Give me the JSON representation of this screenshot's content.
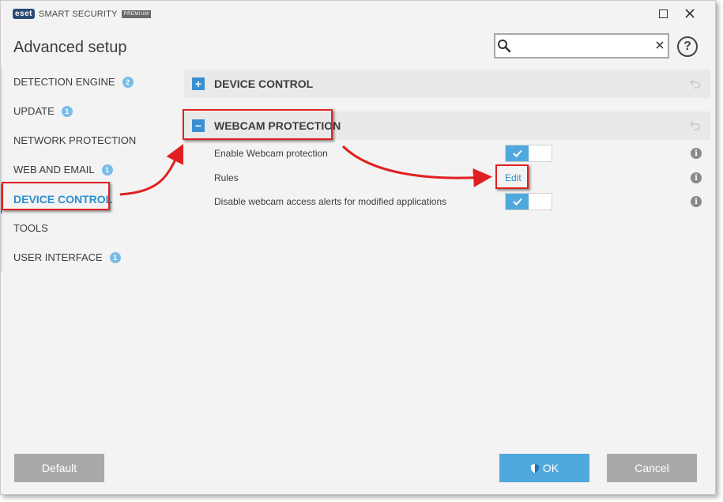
{
  "titlebar": {
    "logo": "eset",
    "product": "SMART SECURITY",
    "badge": "PREMIUM"
  },
  "header": {
    "title": "Advanced setup",
    "search_value": "",
    "search_placeholder": ""
  },
  "sidebar": {
    "items": [
      {
        "label": "DETECTION ENGINE",
        "badge": "2"
      },
      {
        "label": "UPDATE",
        "badge": "1"
      },
      {
        "label": "NETWORK PROTECTION",
        "badge": ""
      },
      {
        "label": "WEB AND EMAIL",
        "badge": "1"
      },
      {
        "label": "DEVICE CONTROL",
        "badge": "",
        "active": true
      },
      {
        "label": "TOOLS",
        "badge": ""
      },
      {
        "label": "USER INTERFACE",
        "badge": "1"
      }
    ]
  },
  "main": {
    "sections": [
      {
        "title": "DEVICE CONTROL",
        "expanded": false,
        "toggle_glyph": "+"
      },
      {
        "title": "WEBCAM PROTECTION",
        "expanded": true,
        "toggle_glyph": "−"
      }
    ],
    "settings": [
      {
        "label": "Enable Webcam protection",
        "type": "toggle",
        "value": true
      },
      {
        "label": "Rules",
        "type": "link",
        "link_label": "Edit"
      },
      {
        "label": "Disable webcam access alerts for modified applications",
        "type": "toggle",
        "value": true
      }
    ],
    "info_glyph": "i"
  },
  "footer": {
    "default_label": "Default",
    "ok_label": "OK",
    "cancel_label": "Cancel"
  },
  "colors": {
    "accent": "#2c8fd0",
    "toggle_on": "#4fa9dc",
    "annotation": "#e02020",
    "button_gray": "#a9a9a9"
  }
}
